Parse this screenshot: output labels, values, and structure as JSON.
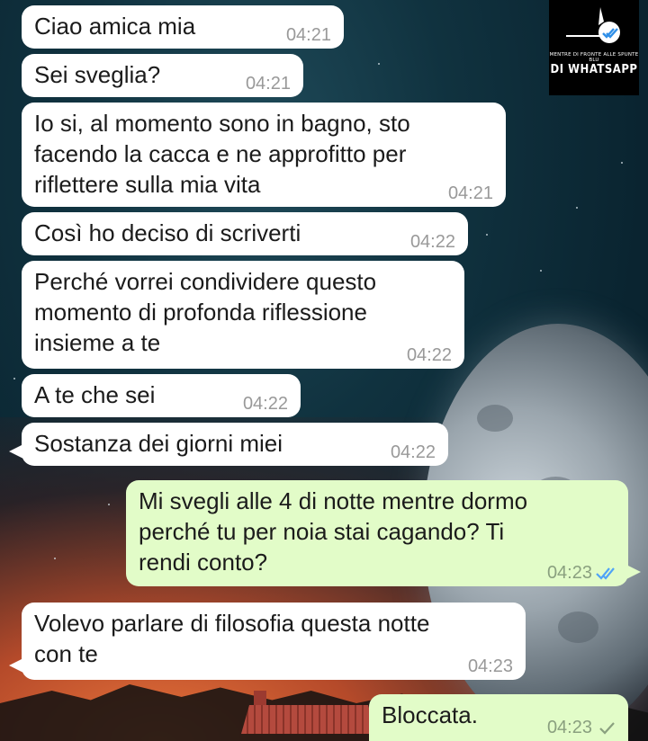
{
  "logo": {
    "small_text": "MENTRE DI FRONTE ALLE SPUNTE BLU",
    "big_text": "DI WHATSAPP",
    "check_color": "#2f8fe8"
  },
  "messages": [
    {
      "direction": "in",
      "text": "Ciao amica mia",
      "time": "04:21"
    },
    {
      "direction": "in",
      "text": "Sei sveglia?",
      "time": "04:21"
    },
    {
      "direction": "in",
      "text": "Io si, al momento sono in bagno, sto\nfacendo la cacca e ne approfitto per\nriflettere sulla mia vita",
      "time": "04:21"
    },
    {
      "direction": "in",
      "text": "Così ho deciso di scriverti",
      "time": "04:22"
    },
    {
      "direction": "in",
      "text": "Perché vorrei condividere questo\nmomento di profonda riflessione\ninsieme a te",
      "time": "04:22"
    },
    {
      "direction": "in",
      "text": "A te che sei",
      "time": "04:22"
    },
    {
      "direction": "in",
      "text": "Sostanza dei giorni miei",
      "time": "04:22"
    },
    {
      "direction": "out",
      "text": "Mi svegli alle 4 di notte mentre dormo\nperché tu per noia stai cagando? Ti\nrendi conto?",
      "time": "04:23",
      "status": "read-double-tick",
      "tick_color": "#4fa3f7"
    },
    {
      "direction": "in",
      "text": "Volevo parlare di filosofia questa notte\ncon te",
      "time": "04:23"
    },
    {
      "direction": "out",
      "text": "Bloccata.",
      "time": "04:23",
      "status": "sent-single-tick",
      "tick_color": "#8aa07f"
    }
  ]
}
